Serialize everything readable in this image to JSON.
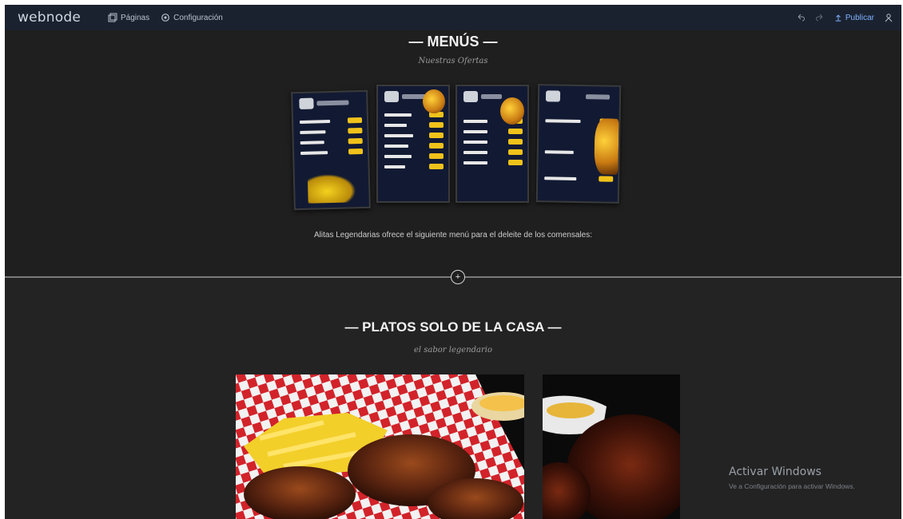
{
  "topbar": {
    "logo": "webnode",
    "nav": [
      {
        "label": "Páginas",
        "icon": "pages-icon"
      },
      {
        "label": "Configuración",
        "icon": "settings-icon"
      }
    ],
    "publish_label": "Publicar",
    "undo_icon": "undo-icon",
    "redo_icon": "redo-icon",
    "user_icon": "user-icon",
    "accent": "#7fb2ff"
  },
  "menus": {
    "title": "— MENÚS —",
    "subtitle": "Nuestras Ofertas",
    "description": "Alitas Legendarias ofrece el siguiente menú para el deleite de los comensales:",
    "card_accent": "#f0c21a"
  },
  "platos": {
    "title": "— PLATOS SOLO DE LA CASA —",
    "subtitle": "el sabor legendario"
  },
  "add_section_icon": "plus-circle-icon",
  "watermark": {
    "title": "Activar Windows",
    "subtitle": "Ve a Configuración para activar Windows."
  }
}
